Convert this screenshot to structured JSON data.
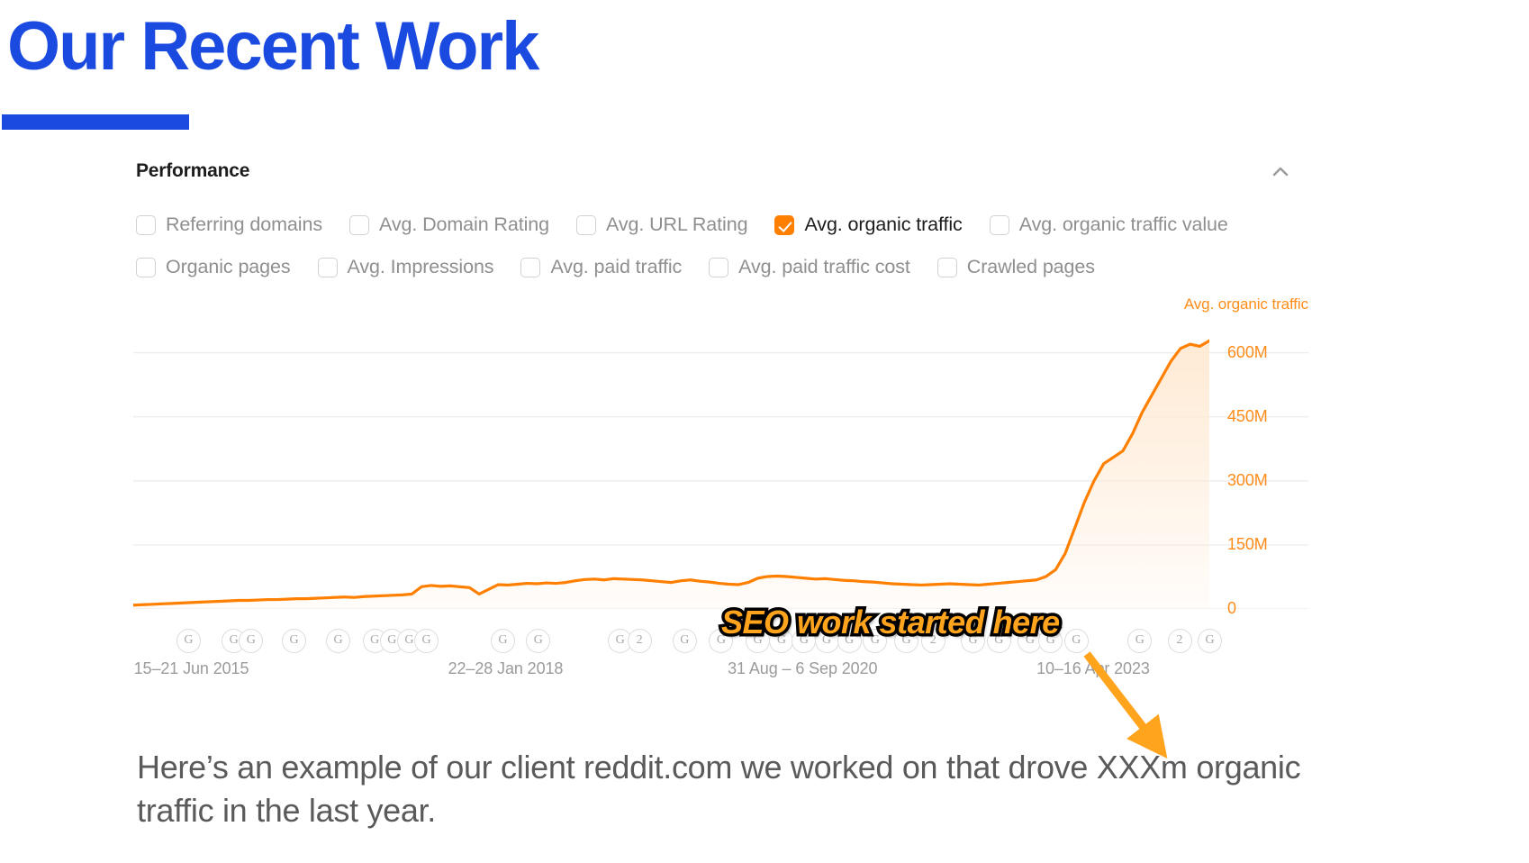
{
  "slide": {
    "title": "Our Recent Work",
    "accent_color": "#1b4ae0",
    "caption": "Here’s an example of our client reddit.com we worked on that drove XXXm organic traffic in the last year."
  },
  "card": {
    "title": "Performance",
    "collapse_icon": "chevron-up-icon"
  },
  "metrics": {
    "row1": [
      {
        "label": "Referring domains",
        "checked": false
      },
      {
        "label": "Avg. Domain Rating",
        "checked": false
      },
      {
        "label": "Avg. URL Rating",
        "checked": false
      },
      {
        "label": "Avg. organic traffic",
        "checked": true
      },
      {
        "label": "Avg. organic traffic value",
        "checked": false
      }
    ],
    "row2": [
      {
        "label": "Organic pages",
        "checked": false
      },
      {
        "label": "Avg. Impressions",
        "checked": false
      },
      {
        "label": "Avg. paid traffic",
        "checked": false
      },
      {
        "label": "Avg. paid traffic cost",
        "checked": false
      },
      {
        "label": "Crawled pages",
        "checked": false
      }
    ]
  },
  "annotation": {
    "text": "SEO work started here",
    "text_color": "#ffa41c",
    "outline_color": "#000000",
    "arrow_color": "#ffa41c"
  },
  "chart_data": {
    "type": "area",
    "title": "",
    "series_label": "Avg. organic traffic",
    "line_color": "#ff8000",
    "fill_color": "#ffe9d2",
    "ylabel": "Avg. organic traffic",
    "xlabel": "",
    "ylim": [
      0,
      675
    ],
    "yticks": [
      0,
      150,
      300,
      450,
      600
    ],
    "ytick_labels": [
      "0",
      "150M",
      "300M",
      "450M",
      "600M"
    ],
    "y_unit": "M",
    "grid": true,
    "legend_position": "top-right",
    "xtick_labels": [
      "15–21 Jun 2015",
      "22–28 Jan 2018",
      "31 Aug – 6 Sep 2020",
      "10–16 Apr 2023"
    ],
    "xtick_positions_pct": [
      5.4,
      34.6,
      62.2,
      89.2
    ],
    "x": [
      0.0,
      1.0,
      2.0,
      3.0,
      4.0,
      5.0,
      6.0,
      7.0,
      8.0,
      9.0,
      10.0,
      11.0,
      12.0,
      13.0,
      14.0,
      15.0,
      16.0,
      17.0,
      18.0,
      19.0,
      20.0,
      21.0,
      22.0,
      23.0,
      24.0,
      25.0,
      26.0,
      27.0,
      28.0,
      29.0,
      30.0,
      31.0,
      32.0,
      33.0,
      34.0,
      35.0,
      36.0,
      37.0,
      38.0,
      39.0,
      40.0,
      41.0,
      42.0,
      43.0,
      44.0,
      45.0,
      46.0,
      47.0,
      48.0,
      49.0,
      50.0,
      51.0,
      52.0,
      53.0,
      54.0,
      55.0,
      56.0,
      57.0,
      58.0,
      59.0,
      60.0,
      61.0,
      62.0,
      63.0,
      64.0,
      65.0,
      66.0,
      67.0,
      68.0,
      69.0,
      70.0,
      71.0,
      72.0,
      73.0,
      74.0,
      75.0,
      76.0,
      77.0,
      78.0,
      79.0,
      80.0,
      81.0,
      82.0,
      83.0,
      84.0,
      85.0,
      86.0,
      87.0,
      88.0,
      89.0,
      90.0,
      91.0,
      92.0,
      93.0,
      94.0,
      95.0,
      96.0,
      97.0,
      98.0,
      99.0,
      100.0
    ],
    "values": [
      9,
      10,
      11,
      12,
      13,
      14,
      15,
      16,
      17,
      18,
      19,
      20,
      20,
      21,
      22,
      22,
      23,
      24,
      24,
      25,
      26,
      27,
      28,
      27,
      29,
      30,
      31,
      32,
      33,
      35,
      52,
      55,
      53,
      54,
      52,
      50,
      35,
      46,
      57,
      56,
      58,
      60,
      59,
      61,
      60,
      62,
      66,
      69,
      70,
      68,
      71,
      70,
      69,
      68,
      66,
      64,
      62,
      66,
      68,
      65,
      63,
      60,
      58,
      57,
      62,
      72,
      76,
      77,
      76,
      74,
      72,
      70,
      71,
      69,
      67,
      66,
      64,
      63,
      61,
      59,
      58,
      57,
      56,
      57,
      58,
      59,
      58,
      57,
      56,
      58,
      60,
      62,
      64,
      66,
      68,
      76,
      92,
      130,
      190,
      250,
      300,
      340,
      355,
      370,
      410,
      460,
      500,
      540,
      580,
      610,
      620,
      615,
      628
    ],
    "annotation_point": {
      "x_pct": 80.5,
      "value": 62,
      "label": "SEO work started here"
    },
    "google_update_markers_label": "G"
  }
}
